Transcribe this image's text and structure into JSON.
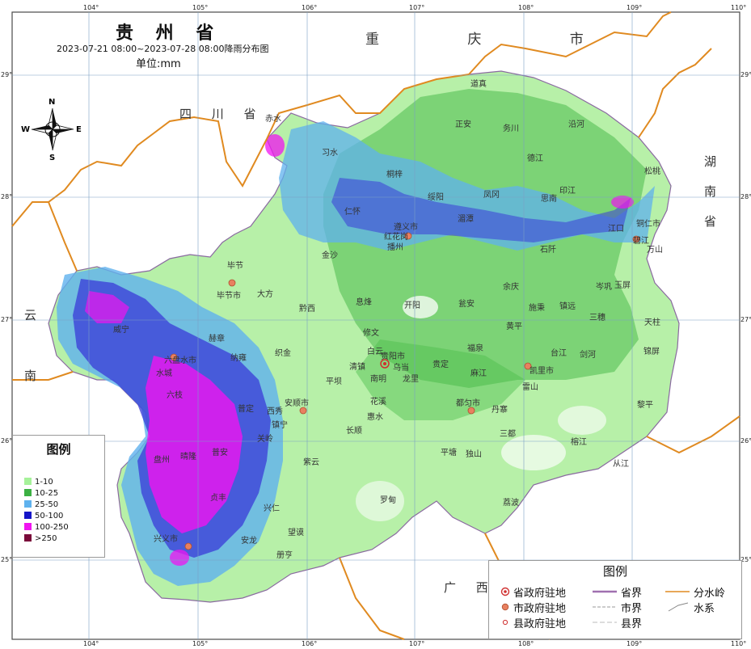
{
  "title": "贵 州 省",
  "subtitle": "2023-07-21 08:00~2023-07-28 08:00降雨分布图",
  "unit": "单位:mm",
  "compass": {
    "n": "N",
    "s": "S",
    "e": "E",
    "w": "W"
  },
  "regions": {
    "chongqing": "重 庆 市",
    "sichuan": "四 川 省",
    "hunan": "湖南省",
    "yunnan": "云南",
    "guangxi": "广 西"
  },
  "ticks": {
    "top": [
      "104°",
      "105°",
      "106°",
      "107°",
      "108°",
      "109°",
      "110°"
    ],
    "bottom": [
      "104°",
      "105°",
      "106°",
      "107°",
      "108°",
      "109°",
      "110°"
    ],
    "left": [
      "29°",
      "28°",
      "27°",
      "26°",
      "25°"
    ],
    "right": [
      "29°",
      "28°",
      "27°",
      "26°",
      "25°"
    ]
  },
  "legend": {
    "title": "图例",
    "items": [
      {
        "label": "1-10",
        "color": "#a6f29a"
      },
      {
        "label": "10-25",
        "color": "#3cb043"
      },
      {
        "label": "25-50",
        "color": "#5fb2ee"
      },
      {
        "label": "50-100",
        "color": "#1515c8"
      },
      {
        "label": "100-250",
        "color": "#f014f0"
      },
      {
        "label": ">250",
        "color": "#7a0a3a"
      }
    ]
  },
  "symbol_legend": {
    "title": "图例",
    "items": [
      {
        "label": "省政府驻地",
        "symbol": "provincial-capital-icon"
      },
      {
        "label": "市政府驻地",
        "symbol": "city-seat-icon"
      },
      {
        "label": "县政府驻地",
        "symbol": "county-seat-icon"
      },
      {
        "label": "省界",
        "symbol": "province-border-icon"
      },
      {
        "label": "市界",
        "symbol": "city-border-icon"
      },
      {
        "label": "县界",
        "symbol": "county-border-icon"
      },
      {
        "label": "分水岭",
        "symbol": "watershed-icon"
      },
      {
        "label": "水系",
        "symbol": "river-icon"
      }
    ]
  },
  "places": [
    "赤水",
    "习水",
    "道真",
    "正安",
    "务川",
    "沿河",
    "德江",
    "松桃",
    "桐梓",
    "绥阳",
    "湄潭",
    "凤冈",
    "印江",
    "思南",
    "江口",
    "铜仁市",
    "碧江",
    "万山",
    "仁怀",
    "遵义市",
    "红花岗",
    "播州",
    "石阡",
    "余庆",
    "岑巩",
    "玉屏",
    "金沙",
    "毕节",
    "毕节市",
    "大方",
    "黔西",
    "瓮安",
    "施秉",
    "镇远",
    "三穗",
    "天柱",
    "威宁",
    "赫章",
    "织金",
    "息烽",
    "开阳",
    "修文",
    "白云",
    "贵阳市",
    "黄平",
    "台江",
    "剑河",
    "锦屏",
    "六盘水市",
    "水城",
    "清镇",
    "乌当",
    "福泉",
    "凯里市",
    "雷山",
    "黎平",
    "纳雍",
    "平坝",
    "龙里",
    "贵定",
    "麻江",
    "榕江",
    "从江",
    "六枝",
    "普定",
    "安顺市",
    "西秀",
    "惠水",
    "长顺",
    "都匀市",
    "丹寨",
    "三都",
    "镇宁",
    "关岭",
    "紫云",
    "罗甸",
    "平塘",
    "独山",
    "荔波",
    "晴隆",
    "普安",
    "贞丰",
    "望谟",
    "兴仁",
    "兴义市",
    "安龙",
    "册亨",
    "盘州",
    "南明",
    "花溪",
    "长顺"
  ]
}
